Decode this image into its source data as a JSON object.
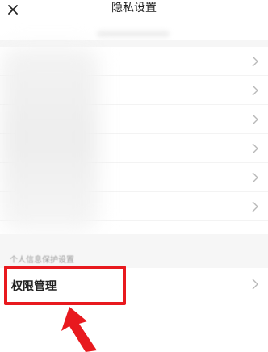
{
  "header": {
    "title": "隐私设置",
    "close_icon": "close-icon"
  },
  "section": {
    "label": "个人信息保护设置"
  },
  "permission_row": {
    "label": "权限管理",
    "chevron_icon": "chevron-right-icon"
  },
  "colors": {
    "highlight": "#e8191e",
    "band": "#f6f6f6",
    "chevron": "#b8b8b8"
  }
}
